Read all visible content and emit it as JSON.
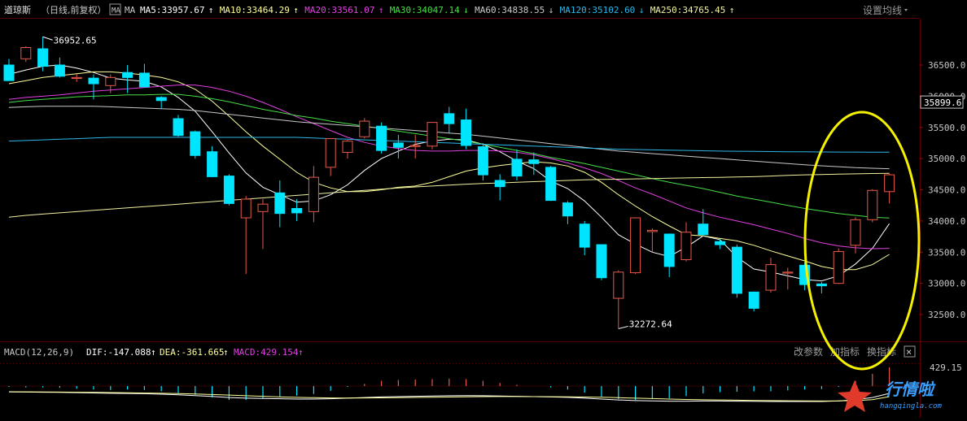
{
  "colors": {
    "background": "#000000",
    "up": "#e8584a",
    "down": "#00e5ff",
    "ma5": "#ffffff",
    "ma10": "#ffff9b",
    "ma20": "#e040e0",
    "ma30": "#46dd46",
    "ma60": "#c8c8c8",
    "ma120": "#2ab7e8",
    "ma250": "#f0f0a0",
    "annotation": "#f5f000",
    "grid": "#5a0000",
    "text": "#c8c8c8"
  },
  "header": {
    "symbol": "道琼斯",
    "period": "（日线,前复权）",
    "ma_button": "MA",
    "ma_label": "MA",
    "ma": [
      {
        "key": "ma5",
        "text": "MA5:33957.67",
        "arrow": "↑"
      },
      {
        "key": "ma10",
        "text": "MA10:33464.29",
        "arrow": "↑"
      },
      {
        "key": "ma20",
        "text": "MA20:33561.07",
        "arrow": "↑"
      },
      {
        "key": "ma30",
        "text": "MA30:34047.14",
        "arrow": "↓"
      },
      {
        "key": "ma60",
        "text": "MA60:34838.55",
        "arrow": "↓"
      },
      {
        "key": "ma120",
        "text": "MA120:35102.60",
        "arrow": "↓"
      },
      {
        "key": "ma250",
        "text": "MA250:34765.45",
        "arrow": "↑"
      }
    ],
    "settings": "设置均线"
  },
  "macd_header": {
    "name": "MACD(12,26,9)",
    "dif": "DIF:-147.088",
    "dif_arrow": "↑",
    "dea": "DEA:-361.665",
    "dea_arrow": "↑",
    "macd": "MACD:429.154",
    "macd_arrow": "↑",
    "buttons": [
      "改参数",
      "加指标",
      "换指标"
    ],
    "close": "×"
  },
  "chart_data": [
    {
      "type": "candlestick",
      "title": "道琼斯（日线,前复权）",
      "ylim": [
        32100,
        36900
      ],
      "yticks": [
        "36500.0",
        "36000.0",
        "35500.0",
        "35000.0",
        "34500.0",
        "34000.0",
        "33500.0",
        "33000.0",
        "32500.0"
      ],
      "ytick_values": [
        36500,
        36000,
        35500,
        35000,
        34500,
        34000,
        33500,
        33000,
        32500
      ],
      "current_price_label": "35899.6",
      "current_price": 35899.6,
      "high_label": "36952.65",
      "high_value": 36952.65,
      "low_label": "32272.64",
      "low_value": 32272.64,
      "candles": [
        {
          "o": 36500,
          "h": 36600,
          "l": 36250,
          "c": 36250
        },
        {
          "o": 36600,
          "h": 36800,
          "l": 36550,
          "c": 36780
        },
        {
          "o": 36760,
          "h": 36952.65,
          "l": 36400,
          "c": 36480
        },
        {
          "o": 36500,
          "h": 36620,
          "l": 36300,
          "c": 36320
        },
        {
          "o": 36300,
          "h": 36350,
          "l": 36230,
          "c": 36300
        },
        {
          "o": 36290,
          "h": 36350,
          "l": 35950,
          "c": 36200
        },
        {
          "o": 36170,
          "h": 36350,
          "l": 36050,
          "c": 36300
        },
        {
          "o": 36380,
          "h": 36500,
          "l": 36050,
          "c": 36300
        },
        {
          "o": 36370,
          "h": 36520,
          "l": 36150,
          "c": 36150
        },
        {
          "o": 35980,
          "h": 36000,
          "l": 35800,
          "c": 35930
        },
        {
          "o": 35640,
          "h": 35700,
          "l": 35350,
          "c": 35370
        },
        {
          "o": 35430,
          "h": 35450,
          "l": 35000,
          "c": 35050
        },
        {
          "o": 35110,
          "h": 35200,
          "l": 34700,
          "c": 34710
        },
        {
          "o": 34720,
          "h": 34750,
          "l": 34250,
          "c": 34280
        },
        {
          "o": 34050,
          "h": 34400,
          "l": 33150,
          "c": 34350
        },
        {
          "o": 34150,
          "h": 34350,
          "l": 33550,
          "c": 34270
        },
        {
          "o": 34450,
          "h": 34650,
          "l": 33900,
          "c": 34120
        },
        {
          "o": 34200,
          "h": 34350,
          "l": 34000,
          "c": 34130
        },
        {
          "o": 34150,
          "h": 34880,
          "l": 33980,
          "c": 34700
        },
        {
          "o": 34860,
          "h": 34950,
          "l": 34720,
          "c": 35320
        },
        {
          "o": 35100,
          "h": 35300,
          "l": 35000,
          "c": 35280
        },
        {
          "o": 35350,
          "h": 35650,
          "l": 35320,
          "c": 35600
        },
        {
          "o": 35520,
          "h": 35580,
          "l": 35080,
          "c": 35130
        },
        {
          "o": 35250,
          "h": 35380,
          "l": 35000,
          "c": 35180
        },
        {
          "o": 35200,
          "h": 35380,
          "l": 35000,
          "c": 35210
        },
        {
          "o": 35200,
          "h": 35580,
          "l": 35150,
          "c": 35580
        },
        {
          "o": 35720,
          "h": 35830,
          "l": 35400,
          "c": 35560
        },
        {
          "o": 35620,
          "h": 35800,
          "l": 35150,
          "c": 35210
        },
        {
          "o": 35190,
          "h": 35250,
          "l": 34650,
          "c": 34740
        },
        {
          "o": 34650,
          "h": 34750,
          "l": 34330,
          "c": 34550
        },
        {
          "o": 34990,
          "h": 35150,
          "l": 34650,
          "c": 34720
        },
        {
          "o": 34980,
          "h": 35100,
          "l": 34740,
          "c": 34920
        },
        {
          "o": 34860,
          "h": 34880,
          "l": 34320,
          "c": 34330
        },
        {
          "o": 34290,
          "h": 34320,
          "l": 33950,
          "c": 34080
        },
        {
          "o": 33950,
          "h": 34000,
          "l": 33450,
          "c": 33580
        },
        {
          "o": 33620,
          "h": 33620,
          "l": 33050,
          "c": 33090
        },
        {
          "o": 32760,
          "h": 33210,
          "l": 32272.64,
          "c": 33180
        },
        {
          "o": 33170,
          "h": 34060,
          "l": 33150,
          "c": 34050
        },
        {
          "o": 33830,
          "h": 33880,
          "l": 33500,
          "c": 33850
        },
        {
          "o": 33790,
          "h": 33800,
          "l": 33100,
          "c": 33270
        },
        {
          "o": 33380,
          "h": 33980,
          "l": 33350,
          "c": 33820
        },
        {
          "o": 33950,
          "h": 34190,
          "l": 33750,
          "c": 33780
        },
        {
          "o": 33670,
          "h": 33700,
          "l": 33550,
          "c": 33620
        },
        {
          "o": 33580,
          "h": 33620,
          "l": 32770,
          "c": 32840
        },
        {
          "o": 32860,
          "h": 32870,
          "l": 32550,
          "c": 32600
        },
        {
          "o": 32890,
          "h": 33410,
          "l": 32850,
          "c": 33300
        },
        {
          "o": 33170,
          "h": 33250,
          "l": 32900,
          "c": 33180
        },
        {
          "o": 33290,
          "h": 33340,
          "l": 32890,
          "c": 32980
        },
        {
          "o": 32990,
          "h": 33020,
          "l": 32840,
          "c": 32960
        },
        {
          "o": 33000,
          "h": 33560,
          "l": 32990,
          "c": 33510
        },
        {
          "o": 33610,
          "h": 34060,
          "l": 33480,
          "c": 34020
        },
        {
          "o": 34020,
          "h": 34510,
          "l": 33980,
          "c": 34490
        },
        {
          "o": 34470,
          "h": 34760,
          "l": 34280,
          "c": 34740
        }
      ],
      "ma_lines": [
        {
          "key": "ma5",
          "values": [
            36350,
            36420,
            36480,
            36500,
            36450,
            36380,
            36290,
            36260,
            36240,
            36150,
            35980,
            35760,
            35430,
            35090,
            34770,
            34540,
            34420,
            34300,
            34320,
            34420,
            34580,
            34810,
            35000,
            35120,
            35230,
            35280,
            35310,
            35300,
            35230,
            35110,
            34960,
            34840,
            34640,
            34520,
            34320,
            34060,
            33780,
            33630,
            33500,
            33430,
            33580,
            33760,
            33700,
            33420,
            33230,
            33180,
            33120,
            33060,
            33040,
            33120,
            33310,
            33560,
            33957
          ]
        },
        {
          "key": "ma10",
          "values": [
            36200,
            36250,
            36300,
            36330,
            36360,
            36390,
            36390,
            36370,
            36340,
            36300,
            36230,
            36110,
            35920,
            35680,
            35430,
            35200,
            34990,
            34780,
            34620,
            34530,
            34470,
            34470,
            34500,
            34540,
            34560,
            34620,
            34710,
            34800,
            34850,
            34890,
            34920,
            34950,
            34930,
            34880,
            34780,
            34620,
            34420,
            34240,
            34070,
            33920,
            33780,
            33760,
            33720,
            33680,
            33610,
            33520,
            33440,
            33360,
            33270,
            33220,
            33220,
            33300,
            33464
          ]
        },
        {
          "key": "ma20",
          "values": [
            35950,
            35980,
            36000,
            36020,
            36050,
            36080,
            36100,
            36120,
            36140,
            36160,
            36180,
            36180,
            36140,
            36080,
            36000,
            35900,
            35790,
            35670,
            35560,
            35450,
            35340,
            35260,
            35200,
            35160,
            35130,
            35120,
            35120,
            35130,
            35130,
            35120,
            35100,
            35060,
            35000,
            34930,
            34850,
            34760,
            34650,
            34530,
            34430,
            34320,
            34210,
            34130,
            34060,
            34000,
            33940,
            33870,
            33800,
            33720,
            33650,
            33600,
            33570,
            33555,
            33561
          ]
        },
        {
          "key": "ma30",
          "values": [
            35900,
            35930,
            35950,
            35970,
            35990,
            36000,
            36010,
            36020,
            36020,
            36030,
            36030,
            36000,
            35960,
            35910,
            35850,
            35790,
            35740,
            35690,
            35650,
            35600,
            35560,
            35520,
            35480,
            35440,
            35400,
            35360,
            35320,
            35280,
            35230,
            35180,
            35130,
            35080,
            35020,
            34970,
            34920,
            34860,
            34800,
            34740,
            34680,
            34620,
            34570,
            34520,
            34460,
            34400,
            34350,
            34300,
            34250,
            34200,
            34160,
            34120,
            34090,
            34060,
            34047
          ]
        },
        {
          "key": "ma60",
          "values": [
            35820,
            35830,
            35840,
            35840,
            35840,
            35840,
            35830,
            35820,
            35810,
            35800,
            35790,
            35770,
            35740,
            35710,
            35680,
            35650,
            35620,
            35590,
            35570,
            35550,
            35530,
            35510,
            35490,
            35470,
            35450,
            35430,
            35410,
            35390,
            35360,
            35330,
            35300,
            35270,
            35240,
            35210,
            35180,
            35150,
            35120,
            35100,
            35080,
            35060,
            35040,
            35020,
            35000,
            34980,
            34960,
            34940,
            34920,
            34900,
            34885,
            34870,
            34855,
            34845,
            34838
          ]
        },
        {
          "key": "ma120",
          "values": [
            35280,
            35290,
            35300,
            35310,
            35320,
            35330,
            35340,
            35340,
            35340,
            35340,
            35340,
            35340,
            35340,
            35340,
            35340,
            35340,
            35340,
            35340,
            35330,
            35320,
            35310,
            35300,
            35290,
            35280,
            35270,
            35260,
            35250,
            35240,
            35230,
            35220,
            35210,
            35200,
            35190,
            35180,
            35170,
            35160,
            35150,
            35145,
            35140,
            35135,
            35130,
            35125,
            35120,
            35118,
            35115,
            35112,
            35110,
            35108,
            35106,
            35105,
            35104,
            35103,
            35102
          ]
        },
        {
          "key": "ma250",
          "values": [
            34060,
            34090,
            34110,
            34130,
            34150,
            34170,
            34190,
            34210,
            34230,
            34250,
            34270,
            34290,
            34310,
            34330,
            34350,
            34370,
            34390,
            34410,
            34430,
            34450,
            34470,
            34490,
            34510,
            34530,
            34545,
            34560,
            34575,
            34590,
            34600,
            34610,
            34620,
            34630,
            34640,
            34650,
            34660,
            34665,
            34670,
            34675,
            34680,
            34685,
            34690,
            34695,
            34700,
            34705,
            34710,
            34720,
            34730,
            34740,
            34745,
            34750,
            34755,
            34760,
            34765
          ]
        }
      ]
    },
    {
      "type": "macd",
      "title": "MACD(12,26,9)",
      "ylim": [
        -800,
        500
      ],
      "yticks": [
        "429.15"
      ],
      "ytick_values": [
        429.15
      ],
      "dif": [
        -50,
        -60,
        -70,
        -80,
        -100,
        -120,
        -140,
        -150,
        -170,
        -200,
        -240,
        -290,
        -350,
        -420,
        -460,
        -480,
        -500,
        -520,
        -520,
        -500,
        -460,
        -420,
        -380,
        -360,
        -340,
        -320,
        -300,
        -290,
        -300,
        -320,
        -340,
        -360,
        -380,
        -410,
        -460,
        -520,
        -580,
        -620,
        -640,
        -660,
        -660,
        -650,
        -650,
        -660,
        -670,
        -680,
        -680,
        -680,
        -680,
        -650,
        -560,
        -420,
        -147.088
      ],
      "dea": [
        -40,
        -45,
        -55,
        -60,
        -70,
        -80,
        -95,
        -110,
        -125,
        -140,
        -160,
        -190,
        -220,
        -260,
        -300,
        -340,
        -380,
        -410,
        -430,
        -445,
        -450,
        -445,
        -440,
        -430,
        -415,
        -400,
        -385,
        -370,
        -360,
        -355,
        -355,
        -360,
        -365,
        -370,
        -385,
        -400,
        -430,
        -460,
        -490,
        -520,
        -545,
        -565,
        -580,
        -595,
        -610,
        -620,
        -630,
        -640,
        -645,
        -640,
        -620,
        -560,
        -361.665
      ],
      "macd": [
        -20,
        -30,
        -30,
        -40,
        -60,
        -80,
        -90,
        -80,
        -90,
        -120,
        -160,
        -200,
        -260,
        -320,
        -320,
        -280,
        -240,
        -220,
        -180,
        -110,
        -20,
        50,
        120,
        140,
        150,
        160,
        170,
        160,
        120,
        70,
        30,
        0,
        -30,
        -80,
        -150,
        -240,
        -300,
        -320,
        -300,
        -280,
        -230,
        -170,
        -140,
        -130,
        -120,
        -120,
        -100,
        -80,
        -70,
        -20,
        120,
        280,
        429.154
      ]
    }
  ],
  "watermark": {
    "logo_text": "行情啦",
    "url": "hangqingla.com"
  }
}
